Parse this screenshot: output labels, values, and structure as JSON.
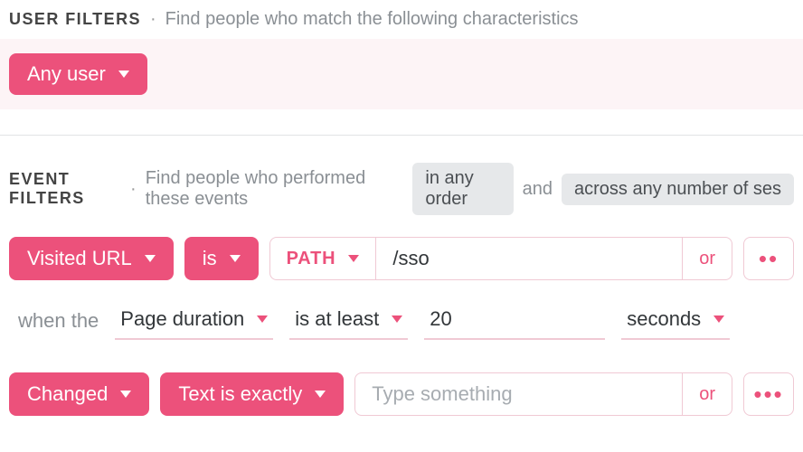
{
  "userFilters": {
    "title": "USER FILTERS",
    "desc": "Find people who match the following characteristics",
    "anyUser": "Any user"
  },
  "eventFilters": {
    "title": "EVENT FILTERS",
    "descPrefix": "Find people who performed these events",
    "orderChip": "in any order",
    "and": "and",
    "scopeChip": "across any number of ses"
  },
  "row1": {
    "visitedUrl": "Visited URL",
    "is": "is",
    "path": "PATH",
    "value": "/sso",
    "or": "or",
    "more": "••"
  },
  "when": {
    "whenThe": "when the",
    "metric": "Page duration",
    "comparator": "is at least",
    "value": "20",
    "unit": "seconds"
  },
  "row2": {
    "changed": "Changed",
    "textIsExactly": "Text is exactly",
    "placeholder": "Type something",
    "or": "or",
    "more": "•••"
  }
}
